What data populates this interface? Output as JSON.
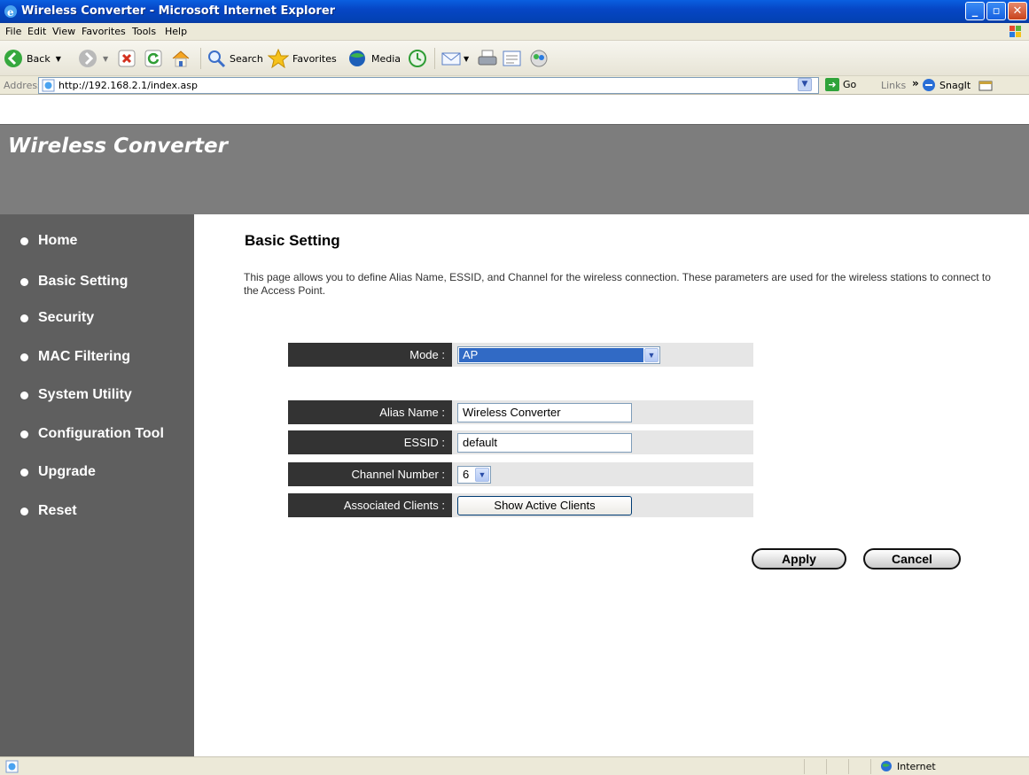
{
  "window": {
    "title": "Wireless Converter - Microsoft Internet Explorer"
  },
  "menu": [
    "File",
    "Edit",
    "View",
    "Favorites",
    "Tools",
    "Help"
  ],
  "toolbar": {
    "back_label": "Back",
    "search_label": "Search",
    "favorites_label": "Favorites",
    "media_label": "Media"
  },
  "address": {
    "label": "Address",
    "url": "http://192.168.2.1/index.asp",
    "go_label": "Go",
    "links_label": "Links",
    "snagit_label": "SnagIt"
  },
  "app": {
    "title": "Wireless Converter"
  },
  "nav": [
    "Home",
    "Basic Setting",
    "Security",
    "MAC Filtering",
    "System Utility",
    "Configuration Tool",
    "Upgrade",
    "Reset"
  ],
  "page": {
    "title": "Basic Setting",
    "description": "This page allows you to define Alias Name, ESSID, and Channel for the wireless connection. These parameters are used for the wireless stations to connect to the Access Point."
  },
  "form": {
    "mode_label": "Mode :",
    "mode_value": "AP",
    "alias_label": "Alias Name :",
    "alias_value": "Wireless Converter",
    "essid_label": "ESSID :",
    "essid_value": "default",
    "channel_label": "Channel Number :",
    "channel_value": "6",
    "clients_label": "Associated Clients :",
    "clients_button": "Show Active Clients"
  },
  "actions": {
    "apply": "Apply",
    "cancel": "Cancel"
  },
  "status": {
    "zone": "Internet"
  }
}
